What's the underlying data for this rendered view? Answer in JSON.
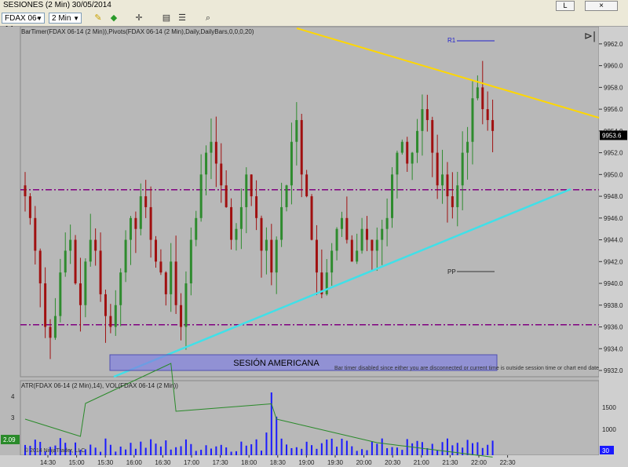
{
  "window": {
    "title": "SESIONES (2 Min)  30/05/2014",
    "btn_l": "L",
    "btn_close": "×"
  },
  "toolbar": {
    "instrument": "FDAX 06-14",
    "period": "2 Min",
    "icons": [
      "pencil-icon",
      "diamond-icon",
      "crosshair-icon",
      "properties-icon",
      "list-icon",
      "zoom-icon"
    ]
  },
  "price_panel": {
    "indicators_label": "BarTimer(FDAX 06-14 (2 Min)),Pivots(FDAX 06-14 (2 Min),Daily,DailyBars,0,0,0,20)",
    "y_ticks": [
      "9962.0",
      "9960.0",
      "9958.0",
      "9956.0",
      "9954.0",
      "9952.0",
      "9950.0",
      "9948.0",
      "9946.0",
      "9944.0",
      "9942.0",
      "9940.0",
      "9938.0",
      "9936.0",
      "9934.0",
      "9932.0"
    ],
    "current_price": "9953.6",
    "r1_label": "R1",
    "pp_label": "PP",
    "session_box": "SESIÓN AMERICANA",
    "bartimer_msg": "Bar timer disabled since either you are disconnected or current time is outside session time or chart end date"
  },
  "lower_panel": {
    "label": "ATR(FDAX 06-14 (2 Min),14), VOL(FDAX 06-14 (2 Min))",
    "left_ticks": [
      "4",
      "3"
    ],
    "atr_value": "2.09",
    "right_ticks": [
      "1500",
      "1000",
      "500"
    ],
    "vol_value": "30",
    "copyright": "© 2014 NinjaTrader, LLC"
  },
  "x_ticks": [
    "14:30",
    "15:00",
    "15:30",
    "16:00",
    "16:30",
    "17:00",
    "17:30",
    "18:00",
    "18:30",
    "19:00",
    "19:30",
    "20:00",
    "20:30",
    "21:00",
    "21:30",
    "22:00",
    "22:30"
  ],
  "colors": {
    "background": "#b8b8b8",
    "up_candle": "#2e8b2e",
    "down_candle": "#a01010",
    "pivot_line": "#800080",
    "upper_trend": "#ffd700",
    "lower_trend": "#40e0e8",
    "session_box": "#8080e0",
    "atr_line": "#2a8a2a",
    "volume": "#1a1aff"
  },
  "chart_data": {
    "type": "candlestick",
    "closes": [
      9948,
      9946,
      9943,
      9940,
      9936,
      9935,
      9937,
      9941,
      9943,
      9944,
      9940,
      9938,
      9942,
      9944,
      9943,
      9939,
      9937,
      9936,
      9938,
      9941,
      9944,
      9946,
      9945,
      9948,
      9947,
      9944,
      9942,
      9941,
      9939,
      9942,
      9938,
      9936,
      9940,
      9944,
      9946,
      9950,
      9952,
      9953,
      9951,
      9949,
      9947,
      9944,
      9945,
      9947,
      9950,
      9948,
      9946,
      9943,
      9944,
      9941,
      9944,
      9947,
      9949,
      9953,
      9955,
      9950,
      9948,
      9944,
      9941,
      9939,
      9941,
      9943,
      9945,
      9946,
      9944,
      9942,
      9943,
      9945,
      9944,
      9943,
      9944,
      9945,
      9946,
      9950,
      9952,
      9953,
      9951,
      9952,
      9954,
      9956,
      9955,
      9952,
      9949,
      9950,
      9948,
      9947,
      9949,
      9952,
      9953,
      9957,
      9958,
      9956,
      9955,
      9954
    ],
    "pivot_levels": {
      "R1": 9962.5,
      "PP": 9941.5,
      "upper_dash": 9948.6,
      "lower_dash": 9936.2
    },
    "ylim": [
      9932,
      9963
    ]
  }
}
